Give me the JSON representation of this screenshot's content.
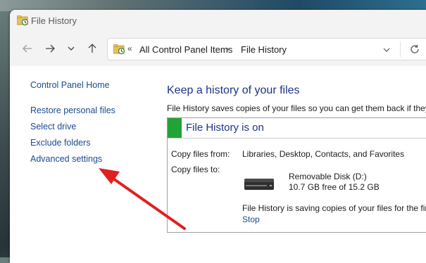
{
  "window": {
    "title": "File History"
  },
  "navigation": {
    "back_icon": "arrow-left-icon",
    "forward_icon": "arrow-right-icon",
    "recent_icon": "chevron-down-icon",
    "up_icon": "arrow-up-icon"
  },
  "address": {
    "overflow": "«",
    "crumbs": [
      "All Control Panel Items",
      "File History"
    ],
    "separator": "›"
  },
  "sidebar": {
    "items": [
      {
        "label": "Control Panel Home"
      },
      {
        "label": "Restore personal files"
      },
      {
        "label": "Select drive"
      },
      {
        "label": "Exclude folders"
      },
      {
        "label": "Advanced settings"
      }
    ]
  },
  "main": {
    "title": "Keep a history of your files",
    "description": "File History saves copies of your files so you can get them back if they",
    "status": {
      "heading": "File History is on",
      "accent_color": "#21a338",
      "copy_from_label": "Copy files from:",
      "copy_from_value": "Libraries, Desktop, Contacts, and Favorites",
      "copy_to_label": "Copy files to:",
      "drive_name": "Removable Disk (D:)",
      "drive_free": "10.7 GB free of 15.2 GB",
      "saving_message": "File History is saving copies of your files for the fir",
      "stop_label": "Stop"
    }
  },
  "annotation": {
    "arrow_color": "#e02020"
  }
}
